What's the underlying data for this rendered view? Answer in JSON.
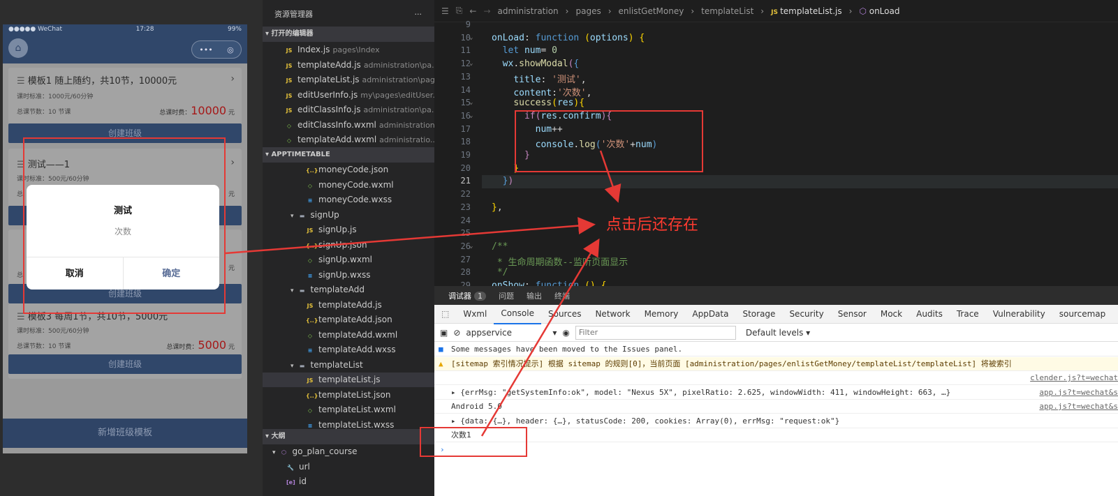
{
  "simulator": {
    "status": {
      "carrier": "●●●●● WeChat",
      "time": "17:28",
      "battery": "99%"
    },
    "capsule": {
      "more": "•••",
      "close": "◎"
    },
    "cards": [
      {
        "title": "模板1 随上随约，共10节，10000元",
        "standard": "课时标准：1000元/60分钟",
        "count": "总课节数：10 节课",
        "total_label": "总课时费：",
        "total_value": "10000",
        "unit": "元",
        "button": "创建班级"
      },
      {
        "title": "测试——1",
        "standard": "课时标准：500元/60分钟",
        "count": "总",
        "total_value": "",
        "unit": "元",
        "button": ""
      },
      {
        "title": "",
        "standard": "",
        "count": "总",
        "total_value": "",
        "unit": "元",
        "button": "创建班级"
      },
      {
        "title": "模板3 每周1节，共10节，5000元",
        "standard": "课时标准：500元/60分钟",
        "count": "总课节数：10 节课",
        "total_label": "总课时费：",
        "total_value": "5000",
        "unit": "元",
        "button": "创建班级"
      }
    ],
    "add_template": "新增班级模板",
    "modal": {
      "title": "测试",
      "content": "次数",
      "cancel": "取消",
      "confirm": "确定"
    }
  },
  "explorer": {
    "title": "资源管理器",
    "more": "···",
    "open_editors_header": "打开的编辑器",
    "open_editors": [
      {
        "name": "Index.js",
        "path": "pages\\Index",
        "type": "js"
      },
      {
        "name": "templateAdd.js",
        "path": "administration\\pa...",
        "type": "js"
      },
      {
        "name": "templateList.js",
        "path": "administration\\pag...",
        "type": "js"
      },
      {
        "name": "editUserInfo.js",
        "path": "my\\pages\\editUser...",
        "type": "js"
      },
      {
        "name": "editClassInfo.js",
        "path": "administration\\pa...",
        "type": "js"
      },
      {
        "name": "editClassInfo.wxml",
        "path": "administration...",
        "type": "wxml"
      },
      {
        "name": "templateAdd.wxml",
        "path": "administratio...",
        "type": "wxml"
      }
    ],
    "project_header": "APPTIMETABLE",
    "tree": [
      {
        "name": "moneyCode.json",
        "type": "json",
        "indent": 2
      },
      {
        "name": "moneyCode.wxml",
        "type": "wxml",
        "indent": 2
      },
      {
        "name": "moneyCode.wxss",
        "type": "wxss",
        "indent": 2
      },
      {
        "name": "signUp",
        "type": "folder",
        "indent": 1
      },
      {
        "name": "signUp.js",
        "type": "js",
        "indent": 2
      },
      {
        "name": "signUp.json",
        "type": "json",
        "indent": 2
      },
      {
        "name": "signUp.wxml",
        "type": "wxml",
        "indent": 2
      },
      {
        "name": "signUp.wxss",
        "type": "wxss",
        "indent": 2
      },
      {
        "name": "templateAdd",
        "type": "folder",
        "indent": 1
      },
      {
        "name": "templateAdd.js",
        "type": "js",
        "indent": 2
      },
      {
        "name": "templateAdd.json",
        "type": "json",
        "indent": 2
      },
      {
        "name": "templateAdd.wxml",
        "type": "wxml",
        "indent": 2
      },
      {
        "name": "templateAdd.wxss",
        "type": "wxss",
        "indent": 2
      },
      {
        "name": "templateList",
        "type": "folder",
        "indent": 1
      },
      {
        "name": "templateList.js",
        "type": "js",
        "indent": 2,
        "selected": true
      },
      {
        "name": "templateList.json",
        "type": "json",
        "indent": 2
      },
      {
        "name": "templateList.wxml",
        "type": "wxml",
        "indent": 2
      },
      {
        "name": "templateList.wxss",
        "type": "wxss",
        "indent": 2
      }
    ],
    "outline_header": "大纲",
    "outline": [
      {
        "name": "go_plan_course",
        "icon": "⬡",
        "indent": 1
      },
      {
        "name": "url",
        "icon": "🔧",
        "indent": 2
      },
      {
        "name": "id",
        "icon": "[e]",
        "indent": 2
      }
    ]
  },
  "editor": {
    "breadcrumb": [
      "administration",
      "pages",
      "enlistGetMoney",
      "templateList",
      "templateList.js",
      "onLoad"
    ],
    "current_line": "21"
  },
  "devtools": {
    "top_tabs": {
      "debugger": "调试器",
      "badge": "1",
      "issues": "问题",
      "output": "输出",
      "terminal": "终端"
    },
    "tabs": [
      "Wxml",
      "Console",
      "Sources",
      "Network",
      "Memory",
      "AppData",
      "Storage",
      "Security",
      "Sensor",
      "Mock",
      "Audits",
      "Trace",
      "Vulnerability",
      "sourcemap"
    ],
    "active_tab": "Console",
    "context": "appservice",
    "filter_placeholder": "Filter",
    "levels": "Default levels ▾",
    "messages": [
      {
        "text": "Some messages have been moved to the Issues panel.",
        "kind": "info",
        "source": ""
      },
      {
        "text": "[sitemap 索引情况提示] 根据 sitemap 的规则[0]，当前页面 [administration/pages/enlistGetMoney/templateList/templateList] 将被索引",
        "kind": "warn",
        "source": ""
      },
      {
        "text": "",
        "kind": "log",
        "source": "clender.js?t=wechat"
      },
      {
        "text": "▸ {errMsg: \"getSystemInfo:ok\", model: \"Nexus 5X\", pixelRatio: 2.625, windowWidth: 411, windowHeight: 663, …}",
        "kind": "log",
        "source": "app.js?t=wechat&s"
      },
      {
        "text": "Android 5.0",
        "kind": "log",
        "source": "app.js?t=wechat&s"
      },
      {
        "text": "▸ {data: {…}, header: {…}, statusCode: 200, cookies: Array(0), errMsg: \"request:ok\"}",
        "kind": "log",
        "source": ""
      },
      {
        "text": "次数1",
        "kind": "log",
        "source": ""
      }
    ],
    "prompt": "›"
  },
  "annotation": {
    "text": "点击后还存在",
    "color": "#ff3b30"
  }
}
